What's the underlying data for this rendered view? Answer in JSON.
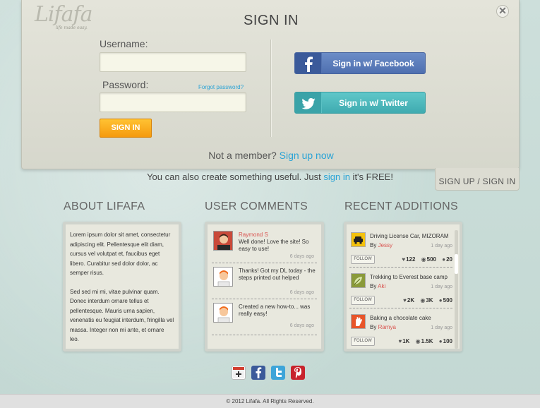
{
  "panel": {
    "logo_text": "Lifafa",
    "logo_tagline": "life made easy.",
    "title": "SIGN IN",
    "close_glyph": "✕",
    "username_label": "Username:",
    "password_label": "Password:",
    "forgot_link": "Forgot password?",
    "signin_button": "SIGN IN",
    "facebook_button": "Sign in w/ Facebook",
    "twitter_button": "Sign in w/ Twitter",
    "not_member_text": "Not a member?",
    "signup_link": "Sign up now"
  },
  "tagline": {
    "before": "You can also create something useful. Just ",
    "link": "sign in",
    "after": " it's FREE!"
  },
  "toggle_tab": "SIGN UP / SIGN IN",
  "about": {
    "heading": "ABOUT LIFAFA",
    "paragraphs": [
      "Lorem ipsum dolor sit amet, consectetur adipiscing elit. Pellentesque elit diam, cursus vel volutpat et, faucibus eget libero. Curabitur sed dolor dolor, ac semper risus.",
      "Sed sed mi mi, vitae pulvinar quam. Donec interdum ornare tellus et pellentesque. Mauris urna sapien, venenatis eu feugiat interdum, fringilla vel massa. Integer non mi ante, et ornare leo."
    ]
  },
  "comments": {
    "heading": "USER COMMENTS",
    "items": [
      {
        "name": "Raymond S",
        "text": "Well done! Love the site! So easy to use!",
        "when": "6 days ago"
      },
      {
        "name": "",
        "text": "Thanks! Got my DL today - the steps printed out helped",
        "when": "6 days ago"
      },
      {
        "name": "",
        "text": "Created a new how-to... was really easy!",
        "when": "6 days ago"
      }
    ]
  },
  "recent": {
    "heading": "RECENT ADDITIONS",
    "follow_label": "FOLLOW",
    "items": [
      {
        "title": "Driving License Car, MIZORAM",
        "by": "By ",
        "author": "Jessy",
        "when": "1 day ago",
        "likes": "122",
        "views": "500",
        "comments": "20",
        "thumb_color": "#f4c20d"
      },
      {
        "title": "Trekking to Everest base camp",
        "by": "By ",
        "author": "Aki",
        "when": "1 day ago",
        "likes": "2K",
        "views": "3K",
        "comments": "500",
        "thumb_color": "#8a9a3a"
      },
      {
        "title": "Baking a chocolate cake",
        "by": "By ",
        "author": "Ramya",
        "when": "1 day ago",
        "likes": "1K",
        "views": "1.5K",
        "comments": "100",
        "thumb_color": "#e8552a"
      }
    ]
  },
  "share_icons": [
    "google-plus-icon",
    "facebook-icon",
    "twitter-icon",
    "pinterest-icon"
  ],
  "footer": "© 2012 Lifafa. All Rights Reserved.",
  "colors": {
    "accent_blue": "#2aa3d6",
    "signin_orange": "#f7a51c",
    "facebook": "#5a78b8",
    "twitter": "#4cbabd",
    "author_red": "#d9534f"
  }
}
